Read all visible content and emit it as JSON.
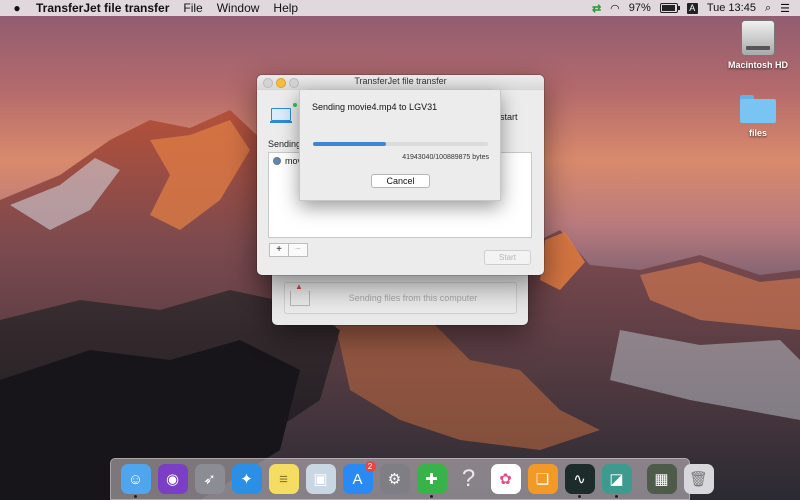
{
  "menubar": {
    "app_name": "TransferJet file transfer",
    "menus": [
      "File",
      "Window",
      "Help"
    ],
    "battery": "97%",
    "input_source": "A",
    "clock": "Tue 13:45"
  },
  "desktop": {
    "icons": [
      {
        "label": "Macintosh HD",
        "icon": "hard-drive-icon"
      },
      {
        "label": "files",
        "icon": "folder-icon"
      }
    ]
  },
  "main_window": {
    "title": "TransferJet file transfer",
    "start_partial": "start",
    "sending_partial": "Sending",
    "file_partial": "mov",
    "add_label": "+",
    "remove_label": "−",
    "start_button": "Start"
  },
  "back_window": {
    "send_label": "Sending files from this computer"
  },
  "sheet": {
    "message": "Sending movie4.mp4 to LGV31",
    "bytes": "41943040/100889875 bytes",
    "progress": 0.4157,
    "cancel_label": "Cancel"
  },
  "dock": {
    "items": [
      {
        "name": "finder",
        "icon": "finder-icon",
        "color": "#4fa6ee",
        "running": true
      },
      {
        "name": "siri",
        "icon": "siri-icon",
        "color": "#7a3fc4",
        "running": false
      },
      {
        "name": "launchpad",
        "icon": "rocket-icon",
        "color": "#8c8c94",
        "running": false
      },
      {
        "name": "safari",
        "icon": "compass-icon",
        "color": "#2b8fe6",
        "running": false
      },
      {
        "name": "notes",
        "icon": "notes-icon",
        "color": "#f5dc62",
        "running": false
      },
      {
        "name": "preview",
        "icon": "preview-icon",
        "color": "#c9d6e3",
        "running": false
      },
      {
        "name": "app-store",
        "icon": "app-store-icon",
        "color": "#2a8af3",
        "running": false,
        "badge": "2"
      },
      {
        "name": "system-preferences",
        "icon": "gear-icon",
        "color": "#7e7e84",
        "running": false
      },
      {
        "name": "transferjet",
        "icon": "transfer-icon",
        "color": "#38b34a",
        "running": true
      },
      {
        "name": "help",
        "icon": "question-icon",
        "color": "transparent",
        "running": false
      },
      {
        "name": "photos",
        "icon": "photos-icon",
        "color": "#ffffff",
        "running": false
      },
      {
        "name": "ibooks",
        "icon": "book-icon",
        "color": "#f39a26",
        "running": false
      },
      {
        "name": "activity-monitor",
        "icon": "activity-icon",
        "color": "#1d2b2a",
        "running": true
      },
      {
        "name": "transfer-app",
        "icon": "transfer-app-icon",
        "color": "#3c9a8e",
        "running": true
      },
      {
        "name": "photo-viewer",
        "icon": "picture-icon",
        "color": "#4e5a4a",
        "running": false
      },
      {
        "name": "trash",
        "icon": "trash-icon",
        "color": "#d8d8dc",
        "running": false
      }
    ]
  }
}
